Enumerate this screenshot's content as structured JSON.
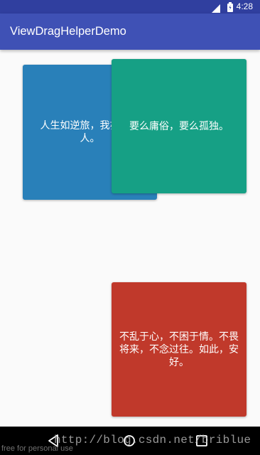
{
  "status_bar": {
    "time": "4:28",
    "icons": [
      "signal-icon",
      "battery-icon"
    ]
  },
  "app_bar": {
    "title": "ViewDragHelperDemo"
  },
  "cards": {
    "blue": {
      "text": "人生如逆旅，我亦是行人。",
      "color": "#2980b9"
    },
    "green": {
      "text": "要么庸俗，要么孤独。",
      "color": "#16a085"
    },
    "red": {
      "text": "不乱于心，不困于情。不畏将来，不念过往。如此，安好。",
      "color": "#c0392b"
    }
  },
  "nav_bar": {
    "buttons": [
      "back-icon",
      "home-icon",
      "recent-apps-icon"
    ]
  },
  "overlay": {
    "watermark": "http://blog.csdn.net/briblue",
    "note": "free for personal use"
  },
  "colors": {
    "primary": "#3f51b5",
    "primary_dark": "#303f9f",
    "background": "#fafafa"
  }
}
